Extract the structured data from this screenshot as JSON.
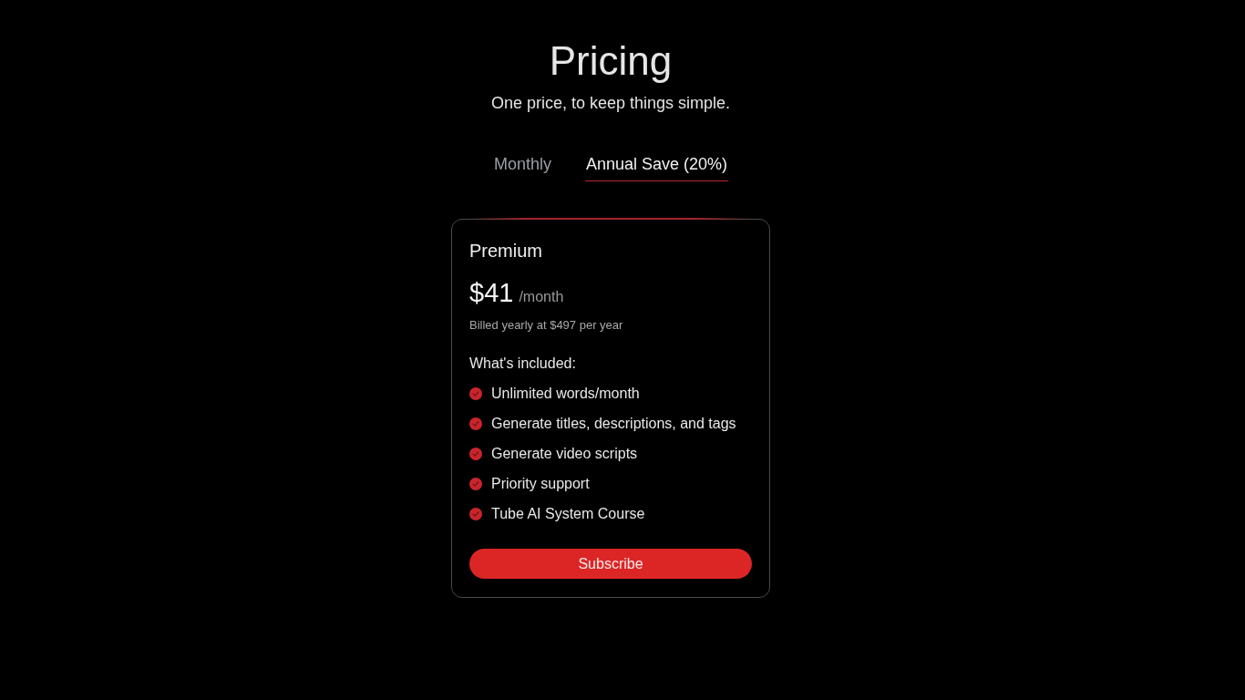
{
  "header": {
    "title": "Pricing",
    "subtitle": "One price, to keep things simple."
  },
  "billing_tabs": [
    {
      "label": "Monthly",
      "selected": false
    },
    {
      "label": "Annual Save (20%)",
      "selected": true
    }
  ],
  "plan": {
    "name": "Premium",
    "price": "$41",
    "period": "/month",
    "billing_note": "Billed yearly at $497 per year",
    "features_heading": "What's included:",
    "features": [
      "Unlimited words/month",
      "Generate titles, descriptions, and tags",
      "Generate video scripts",
      "Priority support",
      "Tube AI System Course"
    ],
    "button": "Subscribe"
  }
}
